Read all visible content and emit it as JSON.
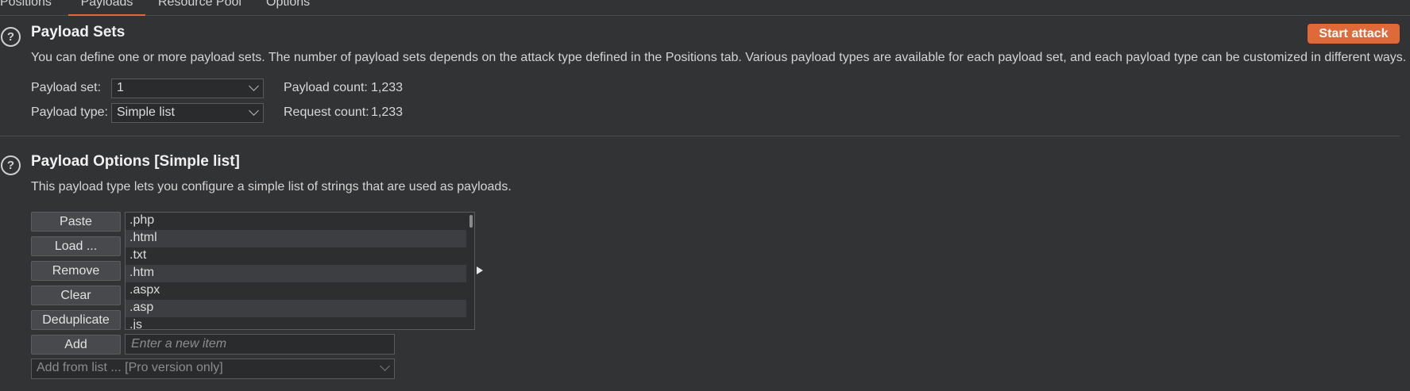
{
  "tabs": [
    "Positions",
    "Payloads",
    "Resource Pool",
    "Options"
  ],
  "payload_sets": {
    "title": "Payload Sets",
    "description": "You can define one or more payload sets. The number of payload sets depends on the attack type defined in the Positions tab. Various payload types are available for each payload set, and each payload type can be customized in different ways.",
    "set_label": "Payload set:",
    "set_value": "1",
    "type_label": "Payload type:",
    "type_value": "Simple list",
    "payload_count_label": "Payload count:",
    "payload_count": "1,233",
    "request_count_label": "Request count:",
    "request_count": "1,233",
    "start_attack": "Start attack"
  },
  "payload_options": {
    "title": "Payload Options [Simple list]",
    "description": "This payload type lets you configure a simple list of strings that are used as payloads.",
    "buttons": [
      "Paste",
      "Load ...",
      "Remove",
      "Clear",
      "Deduplicate"
    ],
    "items": [
      ".php",
      ".html",
      ".txt",
      ".htm",
      ".aspx",
      ".asp",
      ".js"
    ],
    "add_button": "Add",
    "add_placeholder": "Enter a new item",
    "add_from_list": "Add from list ... [Pro version only]"
  },
  "help_icon_text": "?",
  "accent_color": "#e0693a"
}
